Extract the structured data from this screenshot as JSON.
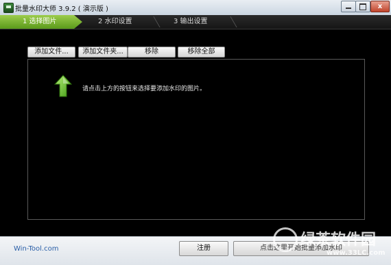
{
  "window": {
    "title": "批量水印大师 3.9.2 ( 演示版 )",
    "controls": {
      "close": "x"
    }
  },
  "steps": [
    {
      "label": "1 选择图片",
      "active": true
    },
    {
      "label": "2 水印设置",
      "active": false
    },
    {
      "label": "3 输出设置",
      "active": false
    }
  ],
  "toolbar": {
    "add_file": "添加文件...",
    "add_folder": "添加文件夹...",
    "remove": "移除",
    "remove_all": "移除全部"
  },
  "main": {
    "hint": "请点击上方的按钮来选择要添加水印的图片。",
    "arrow_icon": "green-up-arrow-icon",
    "accent": "#7cc23a"
  },
  "footer": {
    "site": "Win-Tool.com",
    "register": "注册",
    "start": "点击这里开始批量添加水印"
  },
  "watermark": {
    "text": "绿茶软件园",
    "url": "www.33LC.com"
  }
}
